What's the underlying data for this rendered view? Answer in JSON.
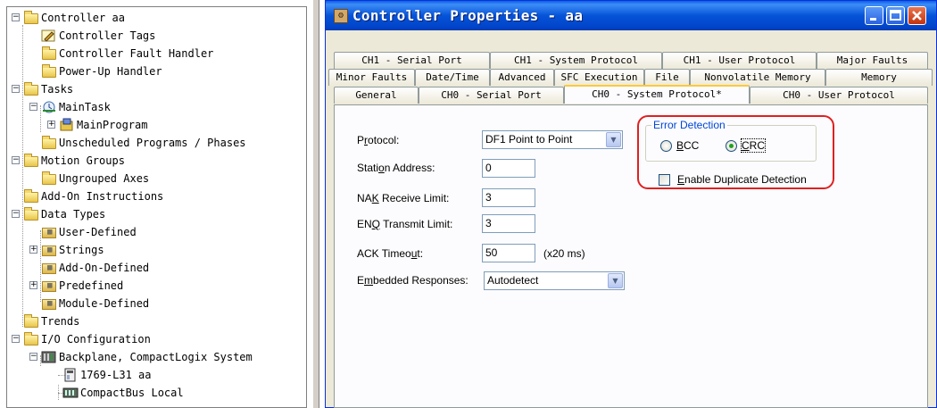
{
  "tree": {
    "items": [
      {
        "label": "Controller aa",
        "icon": "folder-icon"
      },
      {
        "label": "Controller Tags",
        "icon": "tag-edit-icon"
      },
      {
        "label": "Controller Fault Handler",
        "icon": "folder-icon"
      },
      {
        "label": "Power-Up Handler",
        "icon": "folder-icon"
      },
      {
        "label": "Tasks",
        "icon": "folder-icon"
      },
      {
        "label": "MainTask",
        "icon": "task-icon"
      },
      {
        "label": "MainProgram",
        "icon": "program-icon"
      },
      {
        "label": "Unscheduled Programs / Phases",
        "icon": "folder-icon"
      },
      {
        "label": "Motion Groups",
        "icon": "folder-icon"
      },
      {
        "label": "Ungrouped Axes",
        "icon": "folder-icon"
      },
      {
        "label": "Add-On Instructions",
        "icon": "folder-icon"
      },
      {
        "label": "Data Types",
        "icon": "folder-icon"
      },
      {
        "label": "User-Defined",
        "icon": "data-type-folder-icon"
      },
      {
        "label": "Strings",
        "icon": "data-type-folder-icon"
      },
      {
        "label": "Add-On-Defined",
        "icon": "data-type-folder-icon"
      },
      {
        "label": "Predefined",
        "icon": "data-type-folder-icon"
      },
      {
        "label": "Module-Defined",
        "icon": "data-type-folder-icon"
      },
      {
        "label": "Trends",
        "icon": "folder-icon"
      },
      {
        "label": "I/O Configuration",
        "icon": "folder-icon"
      },
      {
        "label": "Backplane, CompactLogix System",
        "icon": "backplane-icon"
      },
      {
        "label": "1769-L31 aa",
        "icon": "controller-module-icon"
      },
      {
        "label": "CompactBus Local",
        "icon": "bus-icon"
      }
    ]
  },
  "dialog": {
    "title": "Controller Properties - aa",
    "tabs_row1": [
      "CH1 - Serial Port",
      "CH1 - System Protocol",
      "CH1 - User Protocol",
      "Major Faults"
    ],
    "tabs_row2": [
      "Minor Faults",
      "Date/Time",
      "Advanced",
      "SFC Execution",
      "File",
      "Nonvolatile Memory",
      "Memory"
    ],
    "tabs_row3": [
      "General",
      "CH0 - Serial Port",
      "CH0 - System Protocol*",
      "CH0 - User Protocol"
    ],
    "active_tab": "CH0 - System Protocol*"
  },
  "form": {
    "protocol_label_pre": "P",
    "protocol_label_ul": "r",
    "protocol_label_post": "otocol:",
    "protocol_value": "DF1 Point to Point",
    "station_label_pre": "Stati",
    "station_label_ul": "o",
    "station_label_post": "n Address:",
    "station_value": "0",
    "nak_label_pre": "NA",
    "nak_label_ul": "K",
    "nak_label_post": " Receive Limit:",
    "nak_value": "3",
    "enq_label_pre": "EN",
    "enq_label_ul": "Q",
    "enq_label_post": " Transmit Limit:",
    "enq_value": "3",
    "ack_label_pre": "ACK Timeo",
    "ack_label_ul": "u",
    "ack_label_post": "t:",
    "ack_value": "50",
    "ack_unit": "(x20 ms)",
    "embedded_label_pre": "E",
    "embedded_label_ul": "m",
    "embedded_label_post": "bedded Responses:",
    "embedded_value": "Autodetect",
    "error_detection_title": "Error Detection",
    "bcc_pre": "",
    "bcc_ul": "B",
    "bcc_post": "CC",
    "crc_pre": "",
    "crc_ul": "C",
    "crc_post": "RC",
    "crc_selected": true,
    "dup_pre": "",
    "dup_ul": "E",
    "dup_post": "nable Duplicate Detection",
    "dup_checked": false
  },
  "colors": {
    "titlebar": "#0054e3",
    "highlight": "#e02020",
    "groupbox_title": "#0046d5"
  }
}
